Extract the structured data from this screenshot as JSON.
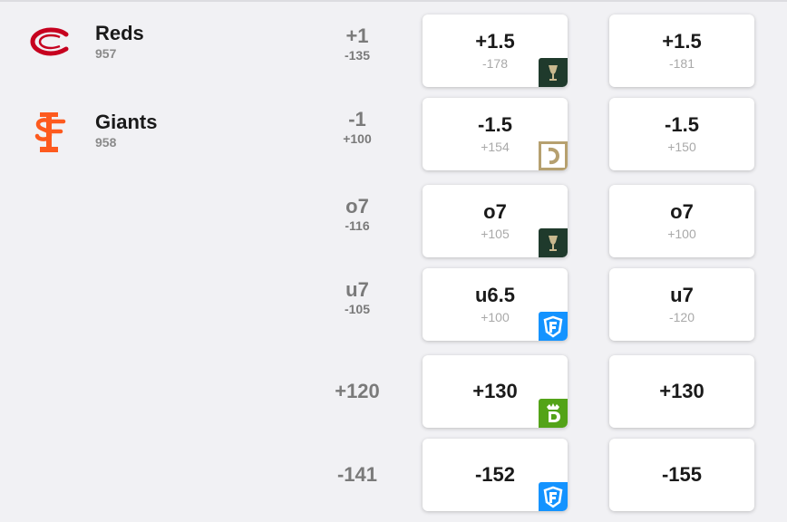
{
  "teams": [
    {
      "name": "Reds",
      "number": "957",
      "logo_icon": "reds-logo-icon",
      "color": "#c6011f"
    },
    {
      "name": "Giants",
      "number": "958",
      "logo_icon": "giants-logo-icon",
      "color": "#fd5a1e"
    }
  ],
  "rows": [
    {
      "open_main": "+1",
      "open_sub": "-135",
      "best_main": "+1.5",
      "best_sub": "-178",
      "book": "circa-sports-icon",
      "consensus_main": "+1.5",
      "consensus_sub": "-181"
    },
    {
      "open_main": "-1",
      "open_sub": "+100",
      "best_main": "-1.5",
      "best_sub": "+154",
      "book": "caesars-icon",
      "consensus_main": "-1.5",
      "consensus_sub": "+150"
    },
    {
      "open_main": "o7",
      "open_sub": "-116",
      "best_main": "o7",
      "best_sub": "+105",
      "book": "circa-sports-icon",
      "consensus_main": "o7",
      "consensus_sub": "+100"
    },
    {
      "open_main": "u7",
      "open_sub": "-105",
      "best_main": "u6.5",
      "best_sub": "+100",
      "book": "fanduel-icon",
      "consensus_main": "u7",
      "consensus_sub": "-120"
    },
    {
      "open_main": "+120",
      "best_main": "+130",
      "book": "draftkings-icon",
      "consensus_main": "+130"
    },
    {
      "open_main": "-141",
      "best_main": "-152",
      "book": "fanduel-icon",
      "consensus_main": "-155"
    }
  ],
  "colors": {
    "background": "#f1f1f4",
    "circa": "#1f3a2c",
    "caesars": "#b6a06f",
    "fanduel": "#1493ff",
    "draftkings": "#53a318"
  }
}
